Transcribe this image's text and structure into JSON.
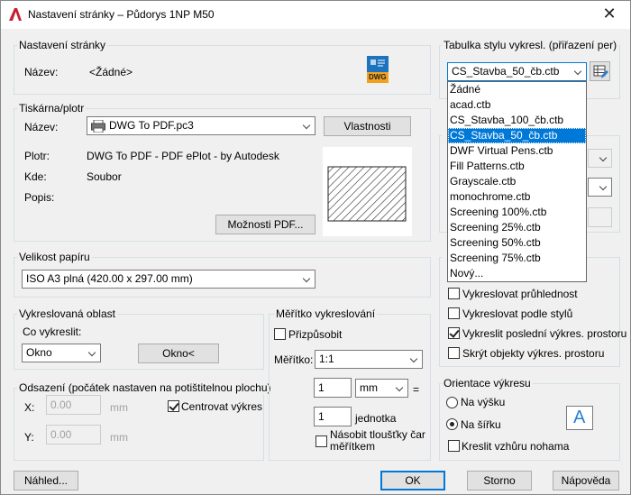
{
  "window": {
    "title": "Nastavení stránky – Půdorys 1NP M50"
  },
  "page_setup": {
    "legend": "Nastavení stránky",
    "name_label": "Název:",
    "name_value": "<Žádné>",
    "dwg_icon_text": "DWG"
  },
  "printer": {
    "legend": "Tiskárna/plotr",
    "name_label": "Název:",
    "name_value": "DWG To PDF.pc3",
    "properties_button": "Vlastnosti",
    "plotter_label": "Plotr:",
    "plotter_value": "DWG To PDF - PDF ePlot - by Autodesk",
    "where_label": "Kde:",
    "where_value": "Soubor",
    "description_label": "Popis:",
    "pdf_options_button": "Možnosti PDF..."
  },
  "paper_size": {
    "legend": "Velikost papíru",
    "value": "ISO A3 plná (420.00 x 297.00 mm)"
  },
  "plot_area": {
    "legend": "Vykreslovaná oblast",
    "what_label": "Co vykreslit:",
    "what_value": "Okno",
    "window_button": "Okno<"
  },
  "plot_offset": {
    "legend": "Odsazení (počátek nastaven na potištitelnou plochu)",
    "x_label": "X:",
    "x_value": "0.00",
    "x_unit": "mm",
    "y_label": "Y:",
    "y_value": "0.00",
    "y_unit": "mm",
    "center_label": "Centrovat výkres",
    "center_checked": true
  },
  "plot_scale": {
    "legend": "Měřítko vykreslování",
    "fit_label": "Přizpůsobit",
    "fit_checked": false,
    "scale_label": "Měřítko:",
    "scale_value": "1:1",
    "value1": "1",
    "unit_value": "mm",
    "equals": "=",
    "value2": "1",
    "unit2_label": "jednotka",
    "lineweights_label": "Násobit tloušťky čar měřítkem",
    "lineweights_checked": false
  },
  "plot_style_table": {
    "legend": "Tabulka stylu vykresl. (přiřazení per)",
    "value": "CS_Stavba_50_čb.ctb",
    "options": [
      "Žádné",
      "acad.ctb",
      "CS_Stavba_100_čb.ctb",
      "CS_Stavba_50_čb.ctb",
      "DWF Virtual Pens.ctb",
      "Fill Patterns.ctb",
      "Grayscale.ctb",
      "monochrome.ctb",
      "Screening 100%.ctb",
      "Screening 25%.ctb",
      "Screening 50%.ctb",
      "Screening 75%.ctb",
      "Nový..."
    ],
    "selected_index": 3
  },
  "plot_options": {
    "transparency_label": "Vykreslovat průhlednost",
    "transparency_checked": false,
    "styles_label": "Vykreslovat podle stylů",
    "styles_checked": false,
    "paperspace_last_label": "Vykreslit poslední výkres. prostoru",
    "paperspace_last_checked": true,
    "hide_objects_label": "Skrýt objekty výkres. prostoru",
    "hide_objects_checked": false
  },
  "orientation": {
    "legend": "Orientace výkresu",
    "portrait_label": "Na výšku",
    "portrait_checked": false,
    "landscape_label": "Na šířku",
    "landscape_checked": true,
    "upside_down_label": "Kreslit vzhůru nohama",
    "upside_down_checked": false,
    "preview_letter": "A"
  },
  "footer": {
    "preview_button": "Náhled...",
    "ok_button": "OK",
    "cancel_button": "Storno",
    "help_button": "Nápověda"
  },
  "colors": {
    "accent": "#0078d7",
    "autocad_red": "#c8202f",
    "dialog_bg": "#f0f0f0"
  }
}
